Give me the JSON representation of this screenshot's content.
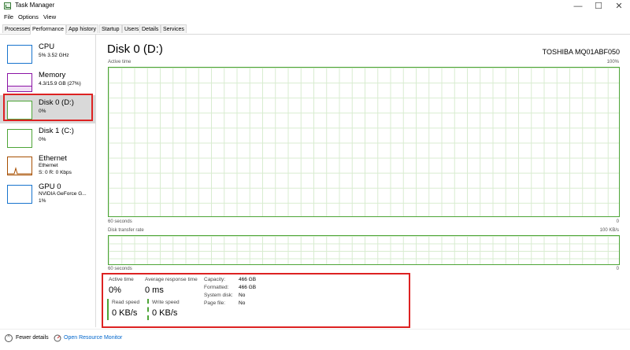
{
  "window": {
    "title": "Task Manager",
    "minimize_glyph": "—",
    "maximize_glyph": "☐",
    "close_glyph": "✕"
  },
  "menu": [
    "File",
    "Options",
    "View"
  ],
  "tabs": [
    "Processes",
    "Performance",
    "App history",
    "Startup",
    "Users",
    "Details",
    "Services"
  ],
  "active_tab": "Performance",
  "sidebar": {
    "items": [
      {
        "title": "CPU",
        "line1": "5% 3.52 GHz",
        "line2": "",
        "color": "#1874cd"
      },
      {
        "title": "Memory",
        "line1": "4.3/15.9 GB (27%)",
        "line2": "",
        "color": "#8b14a5"
      },
      {
        "title": "Disk 0 (D:)",
        "line1": "0%",
        "line2": "",
        "color": "#4da537"
      },
      {
        "title": "Disk 1 (C:)",
        "line1": "0%",
        "line2": "",
        "color": "#4da537"
      },
      {
        "title": "Ethernet",
        "line1": "Ethernet",
        "line2": "S: 0 R: 0 Kbps",
        "color": "#a74f01"
      },
      {
        "title": "GPU 0",
        "line1": "NVIDIA GeForce G...",
        "line2": "1%",
        "color": "#1874cd"
      }
    ],
    "selected_index": 2
  },
  "main": {
    "title": "Disk 0 (D:)",
    "device": "TOSHIBA MQ01ABF050",
    "graph1": {
      "label": "Active time",
      "max": "100%",
      "time": "60 seconds",
      "min": "0"
    },
    "graph2": {
      "label": "Disk transfer rate",
      "max": "100 KB/s",
      "time": "60 seconds",
      "min": "0"
    },
    "stats": {
      "active_time_label": "Active time",
      "active_time_value": "0%",
      "avg_response_label": "Average response time",
      "avg_response_value": "0 ms",
      "read_label": "Read speed",
      "read_value": "0 KB/s",
      "write_label": "Write speed",
      "write_value": "0 KB/s"
    },
    "properties": [
      {
        "label": "Capacity:",
        "value": "466 GB"
      },
      {
        "label": "Formatted:",
        "value": "466 GB"
      },
      {
        "label": "System disk:",
        "value": "No"
      },
      {
        "label": "Page file:",
        "value": "No"
      }
    ]
  },
  "footer": {
    "fewer_details": "Fewer details",
    "open_monitor": "Open Resource Monitor"
  },
  "colors": {
    "disk_green": "#4da537",
    "highlight_red": "#dd2222",
    "link_blue": "#0066cc"
  }
}
